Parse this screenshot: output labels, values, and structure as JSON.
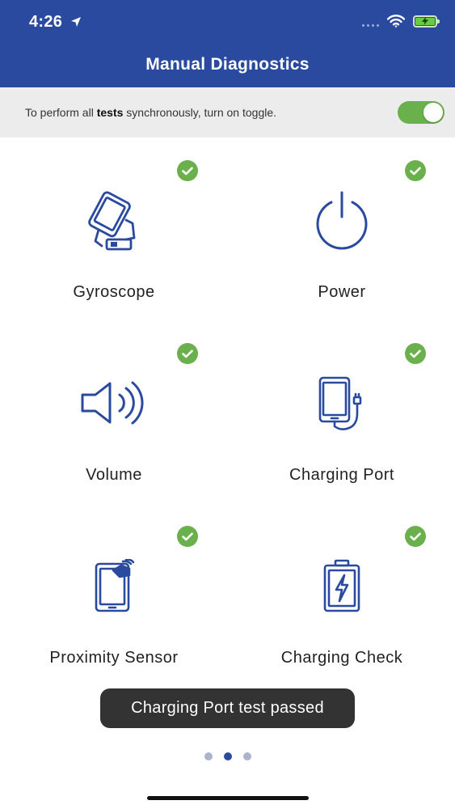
{
  "status_bar": {
    "time": "4:26"
  },
  "header": {
    "title": "Manual Diagnostics"
  },
  "sync_bar": {
    "text_before": "To perform all ",
    "text_bold": "tests",
    "text_after": " synchronously, turn on toggle.",
    "toggle_on": true
  },
  "tests": [
    {
      "label": "Gyroscope",
      "passed": true
    },
    {
      "label": "Power",
      "passed": true
    },
    {
      "label": "Volume",
      "passed": true
    },
    {
      "label": "Charging Port",
      "passed": true
    },
    {
      "label": "Proximity Sensor",
      "passed": true
    },
    {
      "label": "Charging Check",
      "passed": true
    }
  ],
  "toast": {
    "message": "Charging Port test passed"
  },
  "pager": {
    "page_count": 3,
    "active_index": 1
  },
  "colors": {
    "header": "#2a4aa0",
    "icon": "#2a4aa0",
    "success": "#6ab04c",
    "toast": "#333333"
  }
}
